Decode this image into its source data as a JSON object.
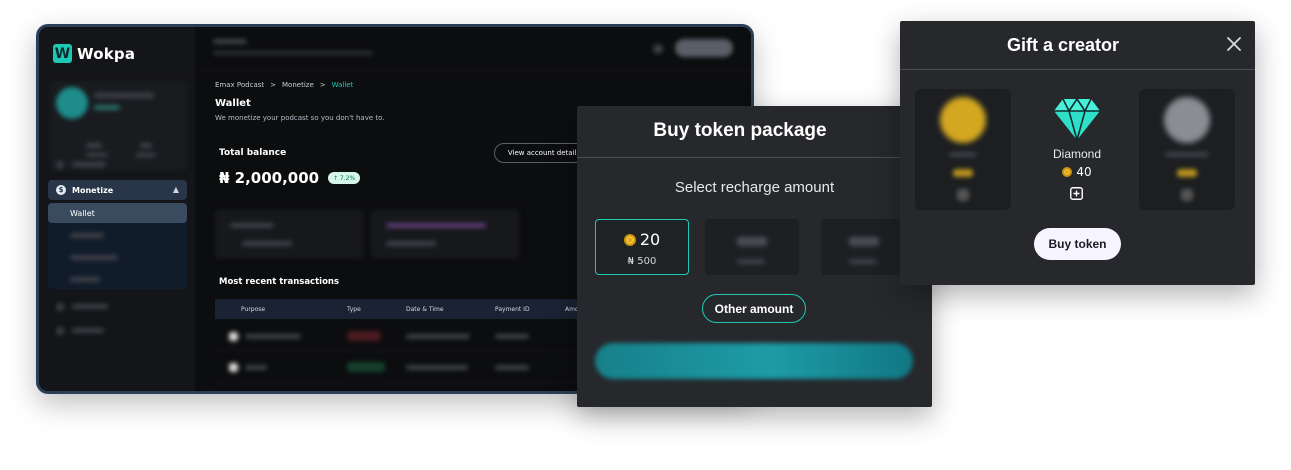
{
  "app": {
    "logo_letter": "W",
    "logo_text": "Wokpa"
  },
  "sidebar": {
    "monetize_label": "Monetize",
    "monetize_icon": "dollar-icon",
    "wallet_label": "Wallet"
  },
  "breadcrumb": {
    "items": [
      "Emax Podcast",
      "Monetize",
      "Wallet"
    ],
    "separator": ">"
  },
  "wallet": {
    "title": "Wallet",
    "subtitle": "We monetize your podcast so you don't have to.",
    "balance_label": "Total balance",
    "balance_value": "₦ 2,000,000",
    "growth_badge": "↑ 7.2%",
    "account_button": "View account details"
  },
  "transactions": {
    "title": "Most recent transactions",
    "columns": [
      "Purpose",
      "Type",
      "Date & Time",
      "Payment ID",
      "Amo"
    ]
  },
  "buy_panel": {
    "title": "Buy token package",
    "subtitle": "Select recharge amount",
    "packages": [
      {
        "tokens": "20",
        "price": "₦ 500",
        "selected": true
      }
    ],
    "other_amount": "Other amount"
  },
  "gift_panel": {
    "title": "Gift a creator",
    "gift": {
      "name": "Diamond",
      "price": "40"
    },
    "buy_button": "Buy token"
  },
  "colors": {
    "accent": "#1ec8b5",
    "panel_bg": "#26282c",
    "window_border": "#2a3f57",
    "coin": "#f3c53a"
  }
}
